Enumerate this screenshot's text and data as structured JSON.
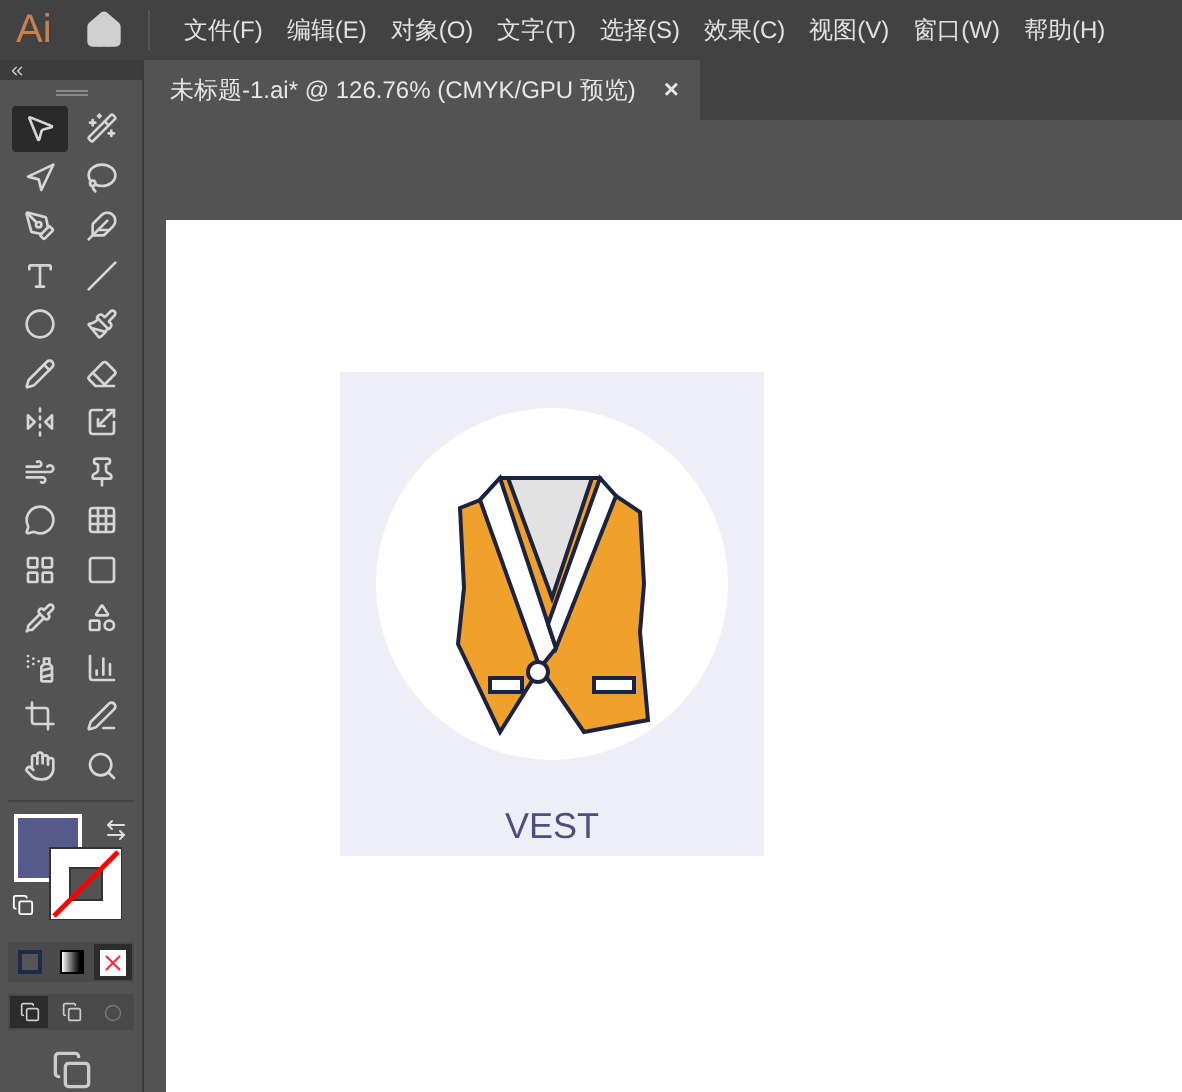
{
  "app": {
    "logo": "Ai"
  },
  "menu": [
    "文件(F)",
    "编辑(E)",
    "对象(O)",
    "文字(T)",
    "选择(S)",
    "效果(C)",
    "视图(V)",
    "窗口(W)",
    "帮助(H)"
  ],
  "tab": {
    "title": "未标题-1.ai* @ 126.76% (CMYK/GPU 预览)",
    "close": "×"
  },
  "tools": [
    {
      "selected": true
    },
    {
      "selected": false
    },
    {
      "selected": false
    },
    {
      "selected": false
    },
    {
      "selected": false
    },
    {
      "selected": false
    },
    {
      "selected": false
    },
    {
      "selected": false
    },
    {
      "selected": false
    },
    {
      "selected": false
    },
    {
      "selected": false
    },
    {
      "selected": false
    },
    {
      "selected": false
    },
    {
      "selected": false
    },
    {
      "selected": false
    },
    {
      "selected": false
    },
    {
      "selected": false
    },
    {
      "selected": false
    },
    {
      "selected": false
    },
    {
      "selected": false
    },
    {
      "selected": false
    },
    {
      "selected": false
    },
    {
      "selected": false
    },
    {
      "selected": false
    },
    {
      "selected": false
    },
    {
      "selected": false
    },
    {
      "selected": false
    },
    {
      "selected": false
    }
  ],
  "swatches": {
    "fill": {
      "color": "#565a8a"
    }
  },
  "artwork": {
    "label": "VEST"
  }
}
